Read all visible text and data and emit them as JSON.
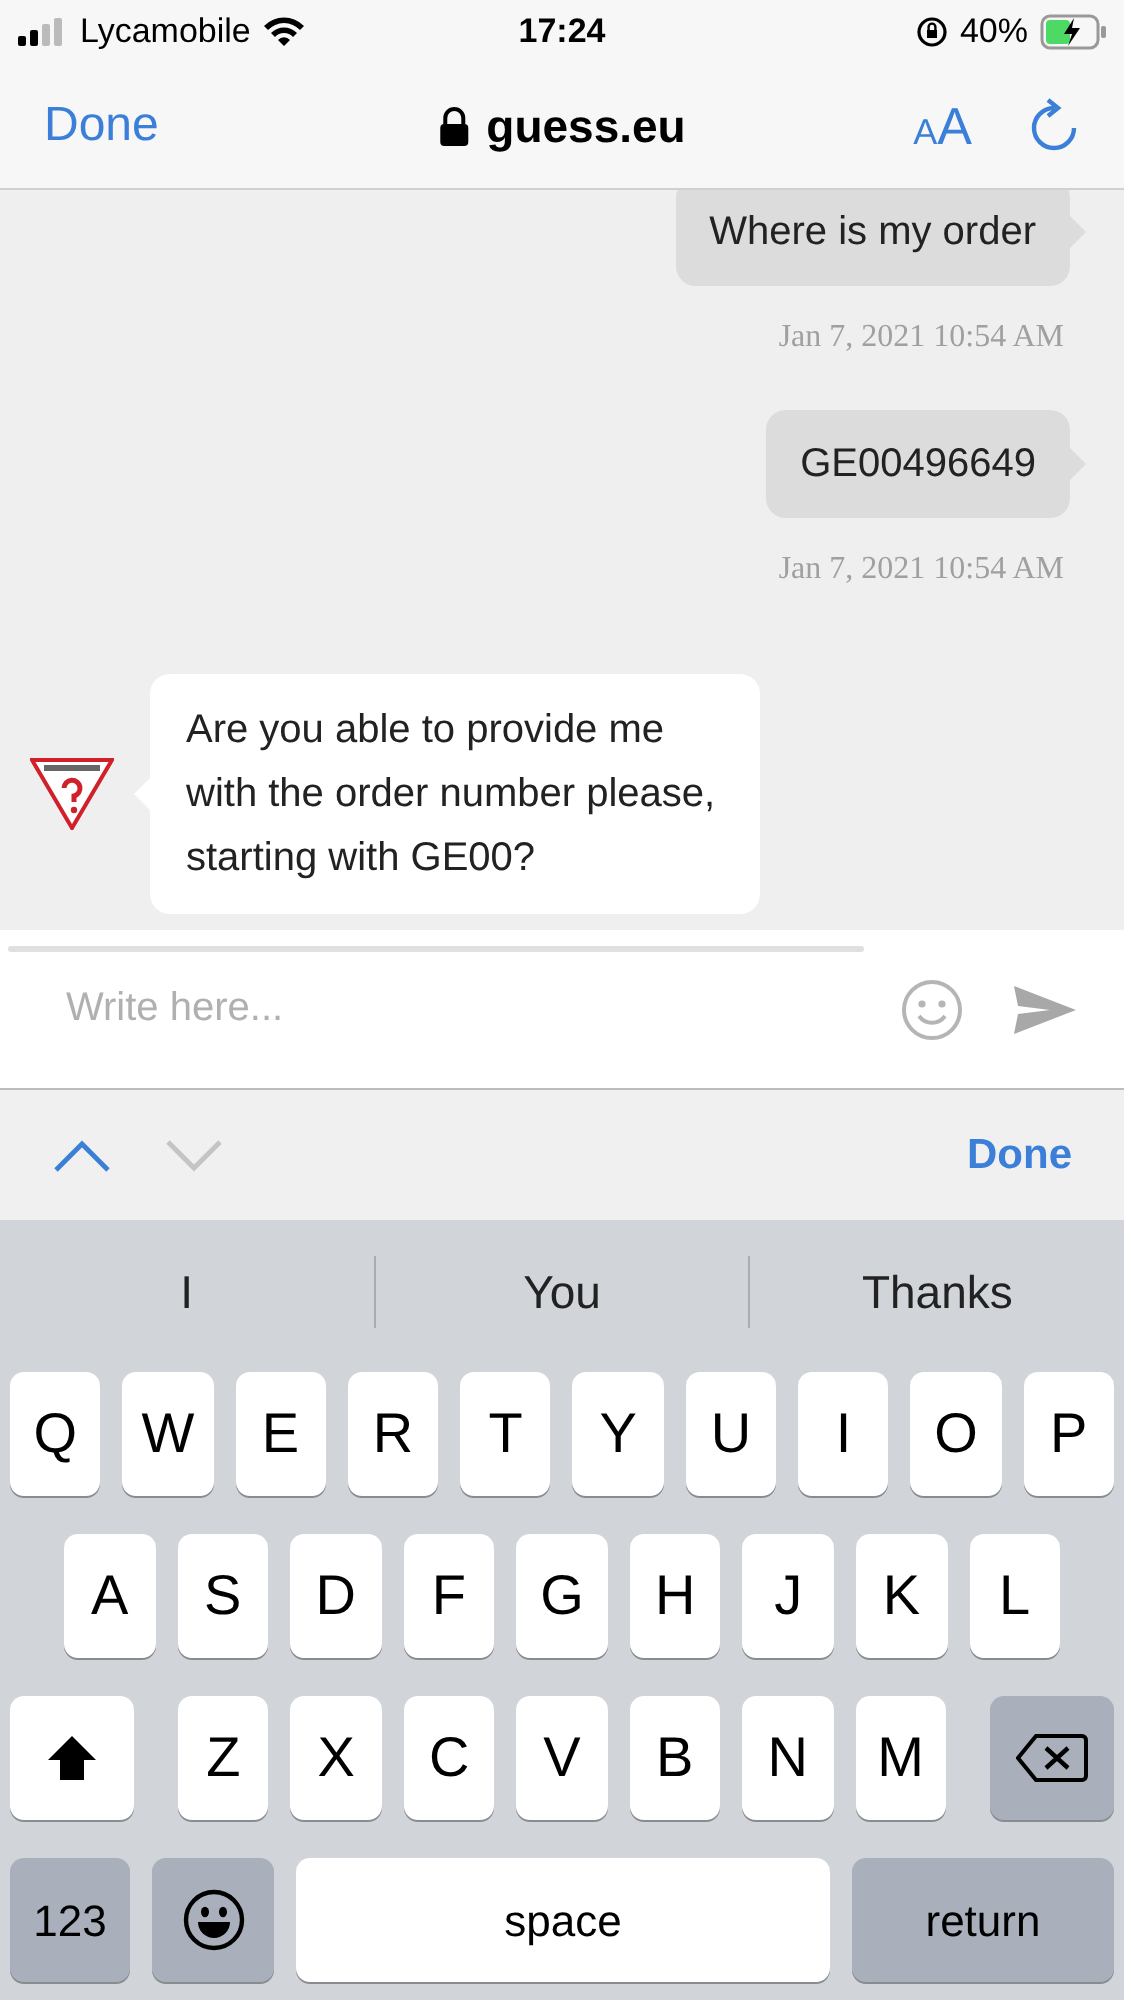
{
  "status_bar": {
    "carrier": "Lycamobile",
    "time": "17:24",
    "battery": "40%"
  },
  "browser_bar": {
    "done": "Done",
    "url": "guess.eu",
    "text_size": "AA"
  },
  "messages": [
    {
      "kind": "user",
      "text": "Where is my order",
      "timestamp": "Jan 7, 2021 10:54 AM"
    },
    {
      "kind": "user",
      "text": "GE00496649",
      "timestamp": "Jan 7, 2021 10:54 AM"
    },
    {
      "kind": "bot",
      "text": "Are you able to provide me with the order number please, starting with GE00?"
    }
  ],
  "composer": {
    "placeholder": "Write here..."
  },
  "form_nav": {
    "previous": {
      "disabled": false
    },
    "next": {
      "disabled": true
    },
    "done": "Done"
  },
  "suggestions": [
    "I",
    "You",
    "Thanks"
  ],
  "keyboard": {
    "rows": [
      {
        "keys": [
          {
            "kind": "letter",
            "label": "Q"
          },
          {
            "kind": "letter",
            "label": "W"
          },
          {
            "kind": "letter",
            "label": "E"
          },
          {
            "kind": "letter",
            "label": "R"
          },
          {
            "kind": "letter",
            "label": "T"
          },
          {
            "kind": "letter",
            "label": "Y"
          },
          {
            "kind": "letter",
            "label": "U"
          },
          {
            "kind": "letter",
            "label": "I"
          },
          {
            "kind": "letter",
            "label": "O"
          },
          {
            "kind": "letter",
            "label": "P"
          }
        ]
      },
      {
        "keys": [
          {
            "kind": "letter",
            "label": "A"
          },
          {
            "kind": "letter",
            "label": "S"
          },
          {
            "kind": "letter",
            "label": "D"
          },
          {
            "kind": "letter",
            "label": "F"
          },
          {
            "kind": "letter",
            "label": "G"
          },
          {
            "kind": "letter",
            "label": "H"
          },
          {
            "kind": "letter",
            "label": "J"
          },
          {
            "kind": "letter",
            "label": "K"
          },
          {
            "kind": "letter",
            "label": "L"
          }
        ]
      },
      {
        "keys": [
          {
            "kind": "shift"
          },
          {
            "kind": "letter",
            "label": "Z"
          },
          {
            "kind": "letter",
            "label": "X"
          },
          {
            "kind": "letter",
            "label": "C"
          },
          {
            "kind": "letter",
            "label": "V"
          },
          {
            "kind": "letter",
            "label": "B"
          },
          {
            "kind": "letter",
            "label": "N"
          },
          {
            "kind": "letter",
            "label": "M"
          },
          {
            "kind": "delete"
          }
        ]
      },
      {
        "keys": [
          {
            "kind": "mode",
            "label": "123"
          },
          {
            "kind": "emoji"
          },
          {
            "kind": "space",
            "label": "space"
          },
          {
            "kind": "return",
            "label": "return"
          }
        ]
      }
    ]
  }
}
